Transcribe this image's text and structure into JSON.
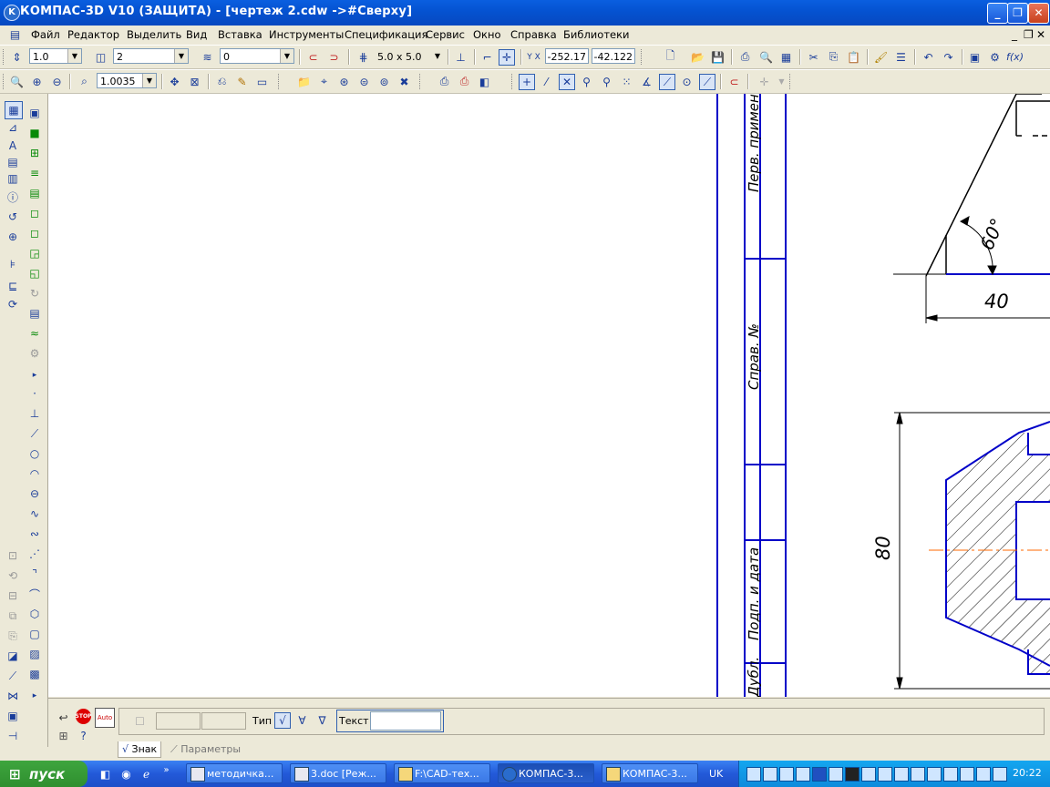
{
  "window": {
    "title": "КОМПАС-3D V10 (ЗАЩИТА) - [чертеж 2.cdw ->#Сверху]",
    "icon_letter": "K",
    "buttons": {
      "minimize": "_",
      "restore": "❐",
      "close": "✕"
    }
  },
  "menu": {
    "items": [
      "Файл",
      "Редактор",
      "Выделить",
      "Вид",
      "Вставка",
      "Инструменты",
      "Спецификация",
      "Сервис",
      "Окно",
      "Справка",
      "Библиотеки"
    ],
    "mdi_controls": [
      "_",
      "❐",
      "✕"
    ]
  },
  "toolbar1": {
    "scale_value": "1.0",
    "layer_value": "2",
    "style_value": "0",
    "grid_step": "5.0 x 5.0",
    "coord_x": "-252.17",
    "coord_y": "-42.122",
    "coord_label": "Y X"
  },
  "toolbar2": {
    "zoom_value": "1.0035"
  },
  "drawing": {
    "stamp_labels": [
      "Перв. примен.",
      "Справ. №",
      "Подп. и дата",
      "Дубл."
    ],
    "dim_angle": "60°",
    "dim_40": "40",
    "dim_80": "80",
    "colors": {
      "line_blue": "#0000C8",
      "line_black": "#000000",
      "axis_orange": "#FF6A00"
    }
  },
  "property_panel": {
    "type_label": "Тип",
    "text_label": "Текст",
    "text_value": "",
    "stop_label": "STOP",
    "auto_label": "Auto",
    "tabs": [
      "Знак",
      "Параметры"
    ]
  },
  "taskbar": {
    "start_label": "пуск",
    "tasks": [
      "методичка...",
      "3.doc [Реж...",
      "F:\\CAD-тех...",
      "КОМПАС-3...",
      "КОМПАС-3..."
    ],
    "lang": "UK",
    "clock": "20:22"
  }
}
